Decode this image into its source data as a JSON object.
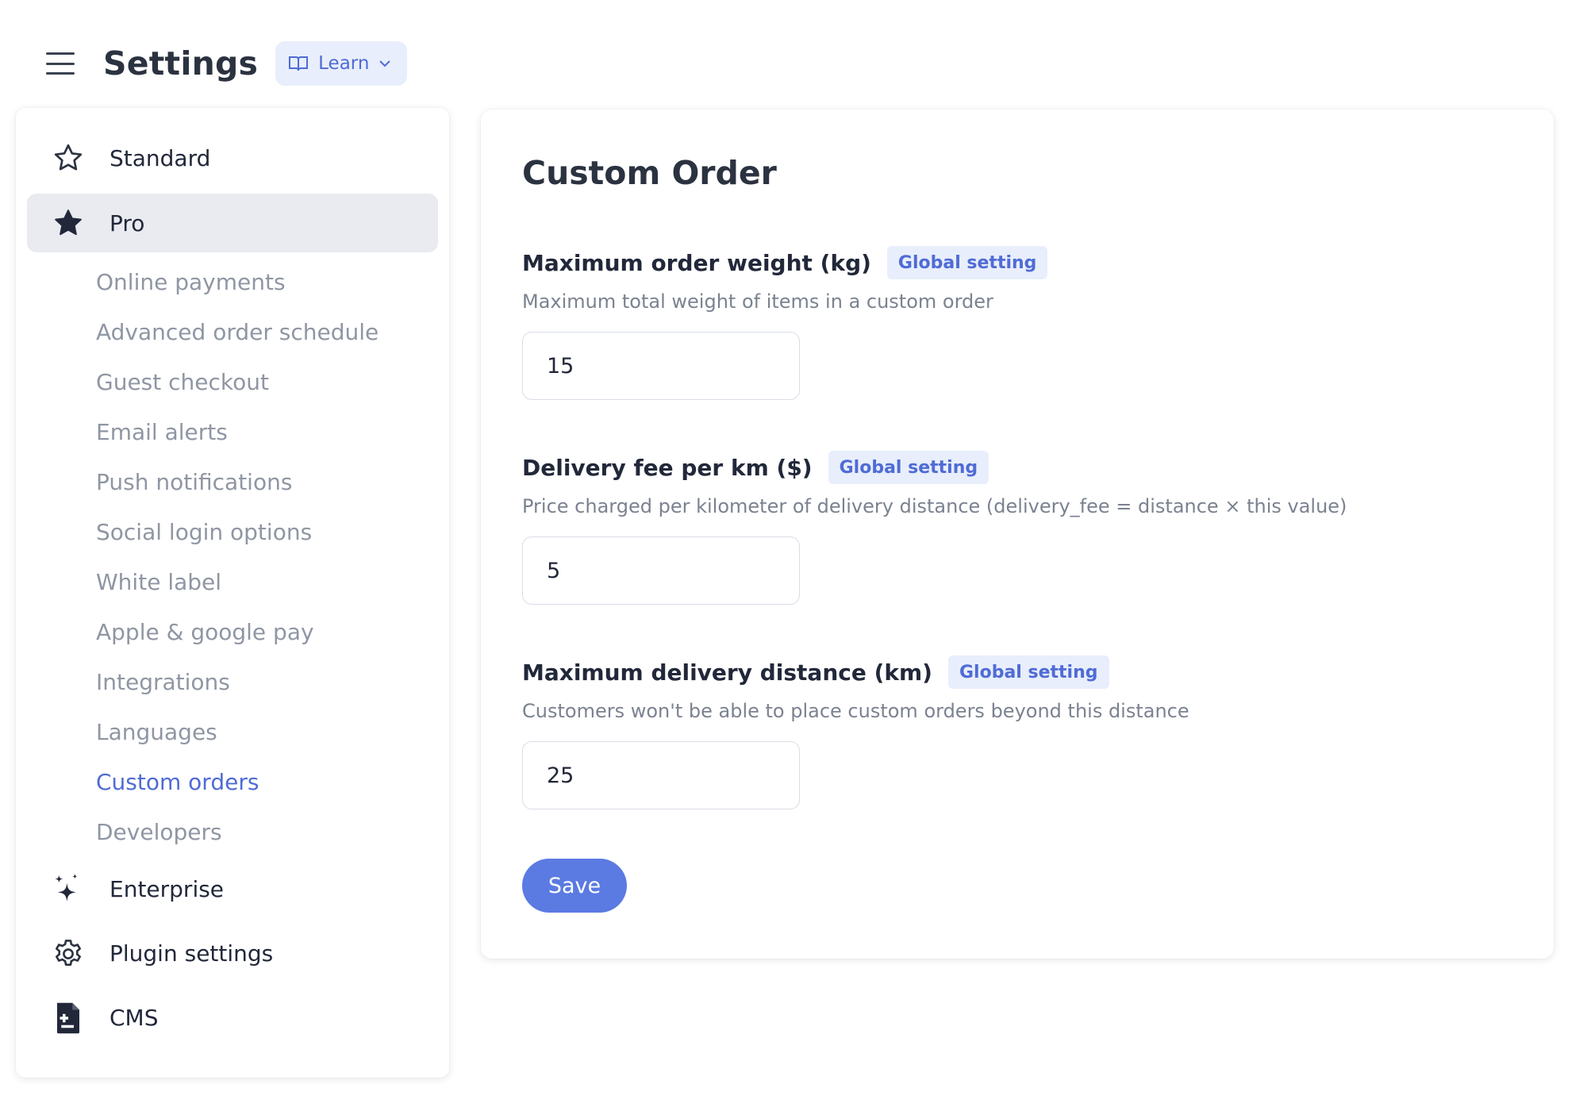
{
  "header": {
    "title": "Settings",
    "learn_label": "Learn",
    "menu_icon": "hamburger-menu-icon",
    "learn_icon": "book-icon",
    "learn_chevron_icon": "chevron-down-icon"
  },
  "sidebar": {
    "standard": {
      "label": "Standard",
      "icon": "star-outline-icon"
    },
    "pro": {
      "label": "Pro",
      "icon": "star-filled-icon"
    },
    "pro_items": [
      "Online payments",
      "Advanced order schedule",
      "Guest checkout",
      "Email alerts",
      "Push notifications",
      "Social login options",
      "White label",
      "Apple & google pay",
      "Integrations",
      "Languages",
      "Custom orders",
      "Developers"
    ],
    "current_item": "Custom orders",
    "enterprise": {
      "label": "Enterprise",
      "icon": "sparkles-icon"
    },
    "plugin_settings": {
      "label": "Plugin settings",
      "icon": "gear-icon"
    },
    "cms": {
      "label": "CMS",
      "icon": "document-icon"
    }
  },
  "main": {
    "title": "Custom Order",
    "fields": [
      {
        "label": "Maximum order weight (kg)",
        "badge": "Global setting",
        "description": "Maximum total weight of items in a custom order",
        "value": "15"
      },
      {
        "label": "Delivery fee per km ($)",
        "badge": "Global setting",
        "description": "Price charged per kilometer of delivery distance (delivery_fee = distance × this value)",
        "value": "5"
      },
      {
        "label": "Maximum delivery distance (km)",
        "badge": "Global setting",
        "description": "Customers won't be able to place custom orders beyond this distance",
        "value": "25"
      }
    ],
    "save_label": "Save"
  },
  "colors": {
    "accent": "#4f6bd6",
    "button": "#5b7ae2",
    "badge_bg": "#e8eefb",
    "active_bg": "#e9ebf0",
    "muted_text": "#8f96a3"
  }
}
